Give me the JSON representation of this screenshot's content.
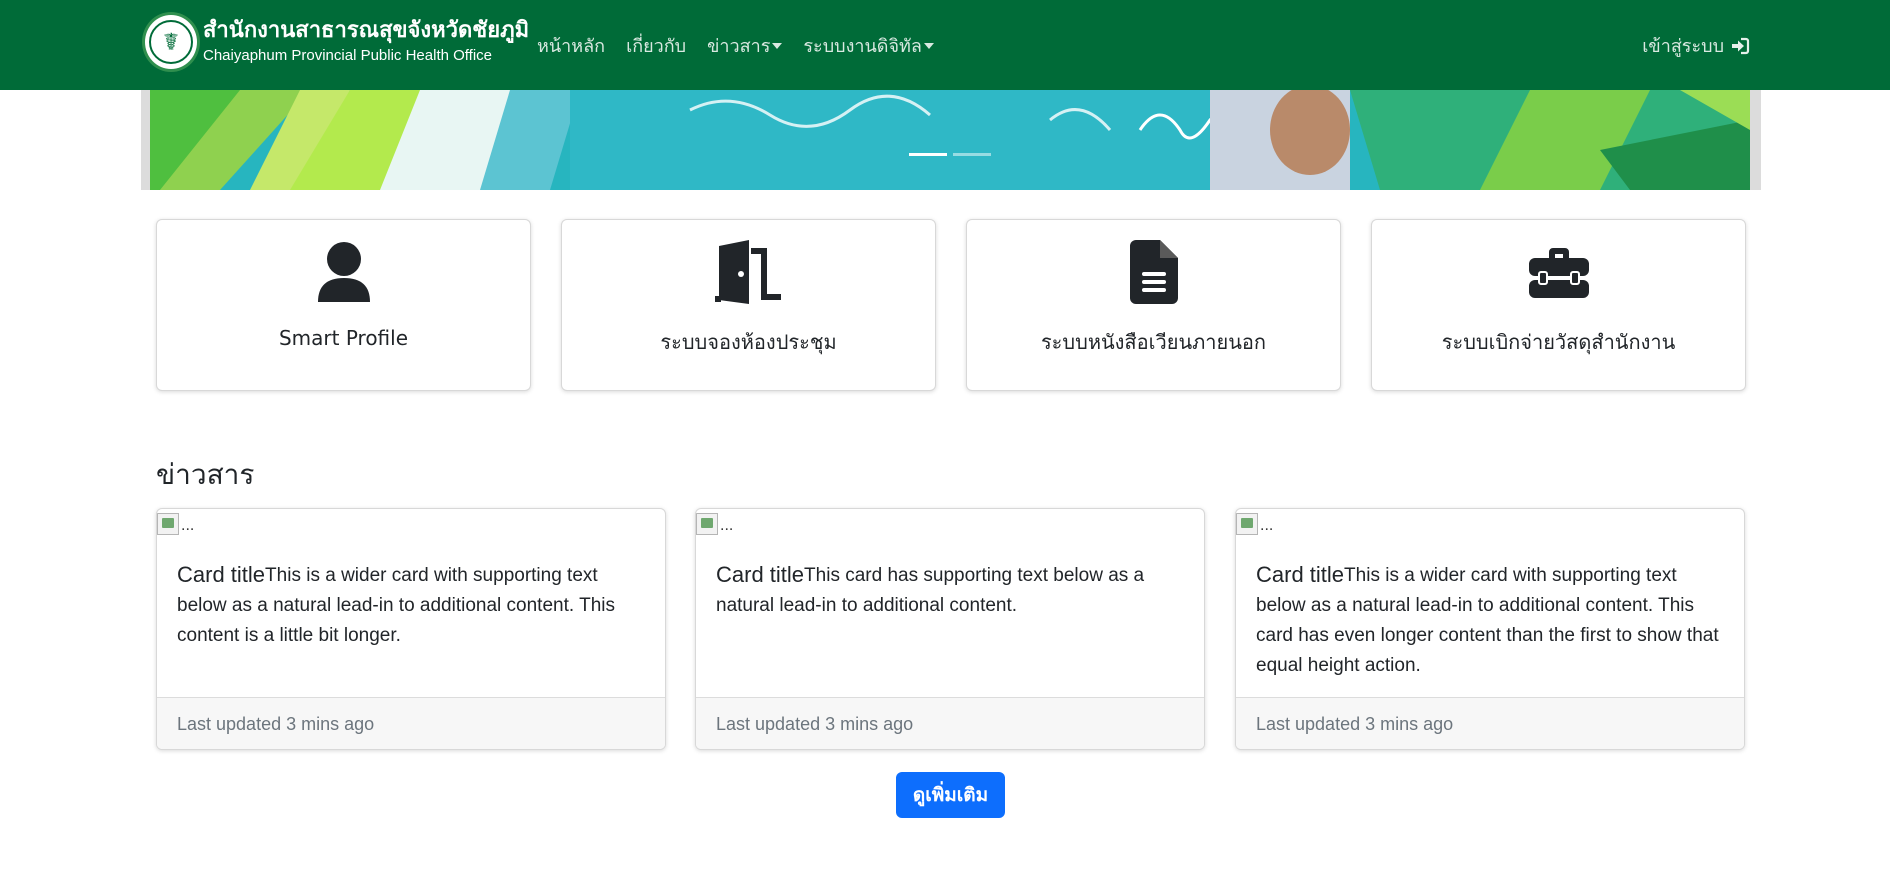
{
  "navbar": {
    "brand_th": "สำนักงานสาธารณสุขจังหวัดชัยภูมิ",
    "brand_en": "Chaiyaphum Provincial Public Health Office",
    "links": [
      {
        "label": "หน้าหลัก",
        "dropdown": false
      },
      {
        "label": "เกี่ยวกับ",
        "dropdown": false
      },
      {
        "label": "ข่าวสาร",
        "dropdown": true
      },
      {
        "label": "ระบบงานดิจิทัล",
        "dropdown": true
      }
    ],
    "login_label": "เข้าสู่ระบบ",
    "bg_color": "#006b38"
  },
  "banner": {
    "slides": 2,
    "active_slide": 1
  },
  "quick_links": [
    {
      "label": "Smart Profile",
      "icon": "user-icon"
    },
    {
      "label": "ระบบจองห้องประชุม",
      "icon": "door-open-icon"
    },
    {
      "label": "ระบบหนังสือเวียนภายนอก",
      "icon": "file-lines-icon"
    },
    {
      "label": "ระบบเบิกจ่ายวัสดุสำนักงาน",
      "icon": "toolbox-icon"
    }
  ],
  "news": {
    "heading": "ข่าวสาร",
    "cards": [
      {
        "img_alt": "...",
        "title": "Card title",
        "text": "This is a wider card with supporting text below as a natural lead-in to additional content. This content is a little bit longer.",
        "footer": "Last updated 3 mins ago"
      },
      {
        "img_alt": "...",
        "title": "Card title",
        "text": "This card has supporting text below as a natural lead-in to additional content.",
        "footer": "Last updated 3 mins ago"
      },
      {
        "img_alt": "...",
        "title": "Card title",
        "text": "This is a wider card with supporting text below as a natural lead-in to additional content. This card has even longer content than the first to show that equal height action.",
        "footer": "Last updated 3 mins ago"
      }
    ],
    "more_label": "ดูเพิ่มเติม"
  }
}
